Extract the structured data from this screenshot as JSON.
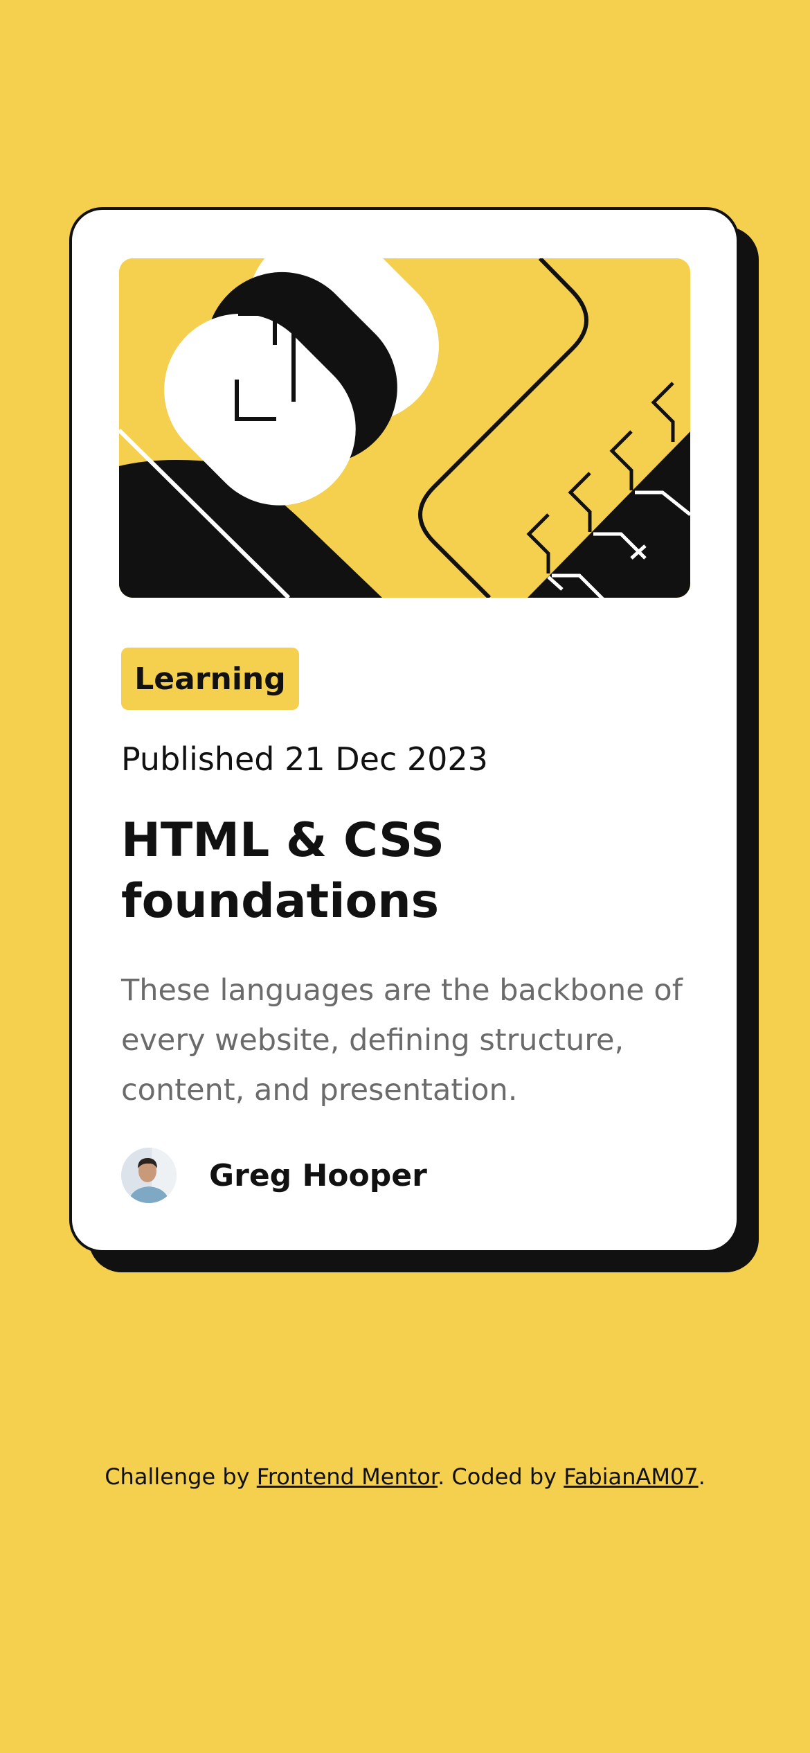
{
  "colors": {
    "page_background": "#F4D04E",
    "card_background": "#FFFFFF",
    "ink": "#111111",
    "muted_text": "#6B6B6B",
    "tag_background": "#F4D04E"
  },
  "card": {
    "image_icon": "abstract-illustration",
    "tag": "Learning",
    "published": "Published 21 Dec 2023",
    "title": "HTML & CSS foundations",
    "description": "These languages are the backbone of every website, defining structure, content, and presentation.",
    "author": {
      "avatar_icon": "author-avatar",
      "name": "Greg Hooper"
    }
  },
  "attribution": {
    "prefix": "Challenge by ",
    "link1": "Frontend Mentor",
    "middle": ". Coded by ",
    "link2": "FabianAM07",
    "suffix": "."
  }
}
